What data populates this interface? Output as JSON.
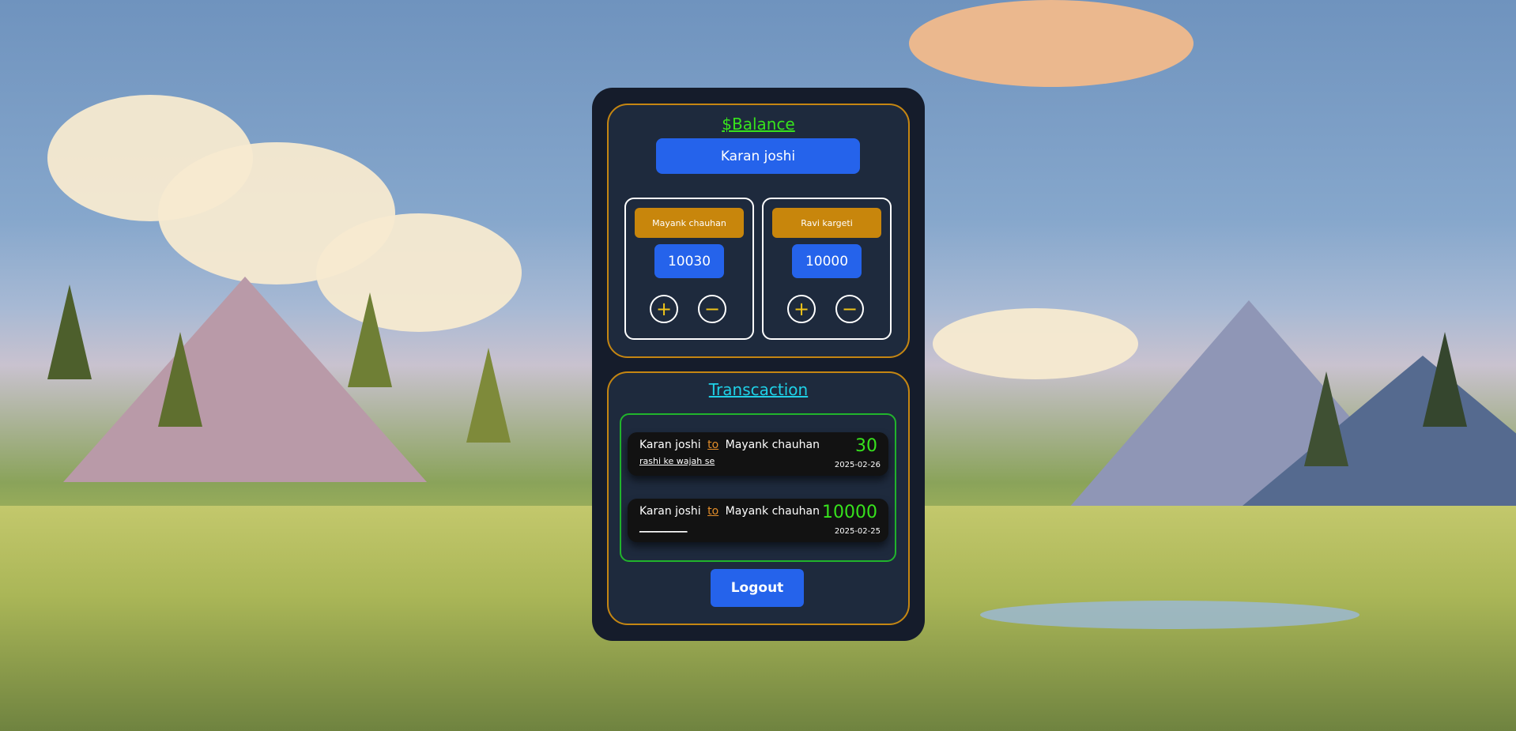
{
  "balance": {
    "title": "$Balance",
    "current_user": "Karan joshi",
    "accounts": [
      {
        "name": "Mayank chauhan",
        "balance": "10030",
        "add_label": "+",
        "subtract_label": "−"
      },
      {
        "name": "Ravi kargeti",
        "balance": "10000",
        "add_label": "+",
        "subtract_label": "−"
      }
    ]
  },
  "transactions": {
    "title": "Transcaction",
    "items": [
      {
        "from": "Karan joshi",
        "connector": "to",
        "to": "Mayank chauhan",
        "note": "rashi ke wajah se",
        "amount": "30",
        "date": "2025-02-26"
      },
      {
        "from": "Karan joshi",
        "connector": "to",
        "to": "Mayank chauhan",
        "note": "___________",
        "amount": "10000",
        "date": "2025-02-25"
      }
    ]
  },
  "logout_label": "Logout",
  "colors": {
    "accent_blue": "#2563eb",
    "gold_border": "#c58612",
    "green_text": "#37e21d",
    "cyan_text": "#1fd0e6"
  }
}
